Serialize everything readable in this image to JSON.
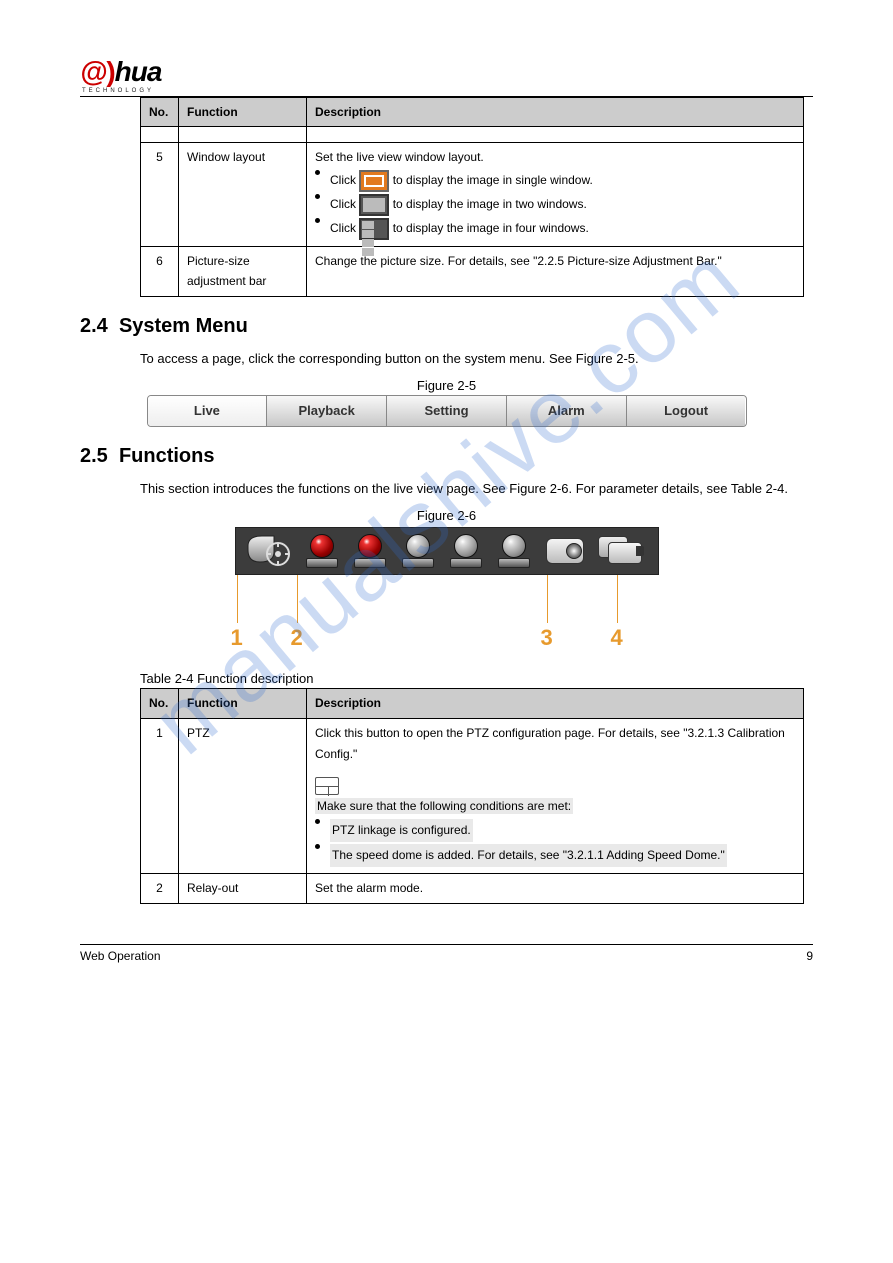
{
  "logo": {
    "text1": "a",
    "text2": "hua",
    "sub": "TECHNOLOGY"
  },
  "table23": {
    "headers": [
      "No.",
      "Function",
      "Description"
    ],
    "row1": {
      "no": "",
      "func": "",
      "desc_intro": "",
      "desc_end": ""
    },
    "row5": {
      "no": "5",
      "func": "Window layout",
      "intro": "Set the live view window layout.",
      "b1": "Click",
      "b1b": "to display the image in single window.",
      "b2": "Click",
      "b2b": "to display the image in two windows.",
      "b3": "Click",
      "b3b": "to display the image in four windows."
    },
    "row6": {
      "no": "6",
      "func": "Picture-size adjustment bar",
      "desc": "Change the picture size. For details, see \"2.2.5 Picture-size Adjustment Bar.\""
    }
  },
  "sec24": {
    "num": "2.4",
    "title": "System Menu",
    "p": "To access a page, click the corresponding button on the system menu. See Figure 2-5.",
    "fig_label": "Figure 2-5",
    "buttons": [
      "Live",
      "Playback",
      "Setting",
      "Alarm",
      "Logout"
    ]
  },
  "sec25": {
    "num": "2.5",
    "title": "Functions",
    "p": "This section introduces the functions on the live view page. See Figure 2-6. For parameter details, see Table 2-4.",
    "fig_label": "Figure 2-6",
    "callouts": [
      "1",
      "2",
      "3",
      "4"
    ],
    "tbl_label": "Table 2-4 Function description",
    "headers": [
      "No.",
      "Function",
      "Description"
    ],
    "row1": {
      "no": "1",
      "func": "PTZ",
      "d1": "Click this button to open the PTZ configuration page. For details, see \"3.2.1.3 Calibration Config.\"",
      "note1": "Make sure that the following conditions are met:",
      "li1": "PTZ linkage is configured.",
      "li2": "The speed dome is added. For details, see \"3.2.1.1 Adding Speed Dome.\""
    },
    "row2": {
      "no": "2",
      "func": "Relay-out",
      "desc": "Set the alarm mode."
    }
  },
  "watermark": "manualshive.com",
  "footer": {
    "left": "Web Operation",
    "right": "9"
  }
}
